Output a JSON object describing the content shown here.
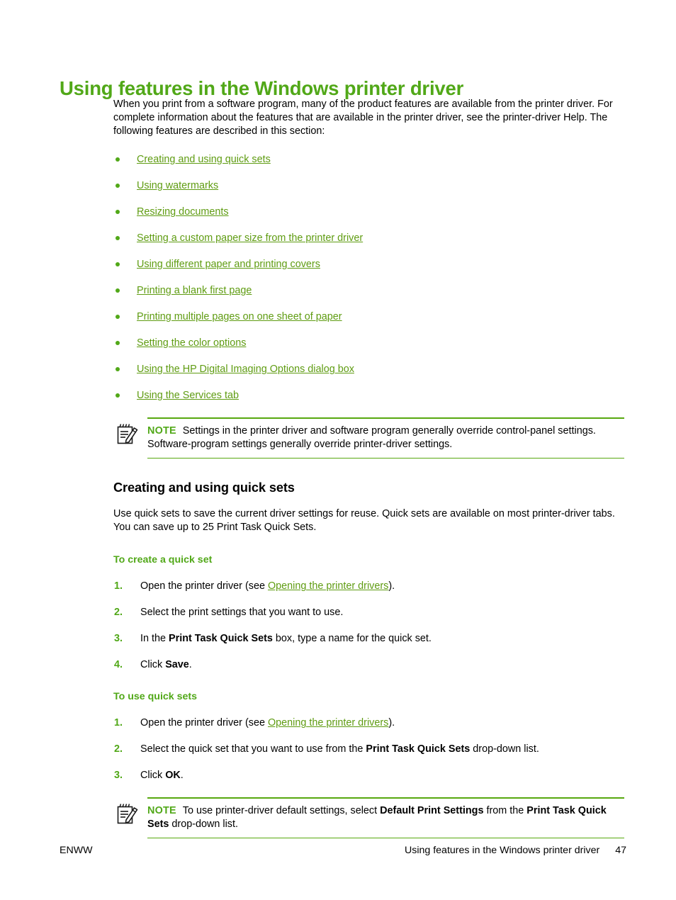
{
  "page": {
    "title": "Using features in the Windows printer driver",
    "intro": "When you print from a software program, many of the product features are available from the printer driver. For complete information about the features that are available in the printer driver, see the printer-driver Help. The following features are described in this section:",
    "accent_green": "#51a818",
    "link_green": "#5f9c12",
    "rule_green": "#57a80f"
  },
  "feature_links": [
    {
      "label": "Creating and using quick sets"
    },
    {
      "label": "Using watermarks"
    },
    {
      "label": "Resizing documents"
    },
    {
      "label": "Setting a custom paper size from the printer driver"
    },
    {
      "label": "Using different paper and printing covers"
    },
    {
      "label": "Printing a blank first page"
    },
    {
      "label": "Printing multiple pages on one sheet of paper"
    },
    {
      "label": "Setting the color options"
    },
    {
      "label": "Using the HP Digital Imaging Options dialog box"
    },
    {
      "label": "Using the Services tab"
    }
  ],
  "note_1": {
    "label": "NOTE",
    "icon": "note-pad-pencil-icon",
    "text": "Settings in the printer driver and software program generally override control-panel settings. Software-program settings generally override printer-driver settings."
  },
  "section": {
    "heading": "Creating and using quick sets",
    "body": "Use quick sets to save the current driver settings for reuse. Quick sets are available on most printer-driver tabs. You can save up to 25 Print Task Quick Sets."
  },
  "proc_create": {
    "heading": "To create a quick set",
    "steps": [
      {
        "num": "1.",
        "pre": "Open the printer driver (see ",
        "link": "Opening the printer drivers",
        "post": ")."
      },
      {
        "num": "2.",
        "pre": "Select the print settings that you want to use.",
        "link": "",
        "post": ""
      },
      {
        "num": "3.",
        "pre": "In the ",
        "bold": "Print Task Quick Sets",
        "post": " box, type a name for the quick set."
      },
      {
        "num": "4.",
        "pre": "Click ",
        "bold": "Save",
        "post": "."
      }
    ]
  },
  "proc_use": {
    "heading": "To use quick sets",
    "steps": [
      {
        "num": "1.",
        "pre": "Open the printer driver (see ",
        "link": "Opening the printer drivers",
        "post": ")."
      },
      {
        "num": "2.",
        "pre": "Select the quick set that you want to use from the ",
        "bold": "Print Task Quick Sets",
        "post": " drop-down list."
      },
      {
        "num": "3.",
        "pre": "Click ",
        "bold": "OK",
        "post": "."
      }
    ]
  },
  "note_2": {
    "label": "NOTE",
    "icon": "note-pad-pencil-icon",
    "text_1": "To use printer-driver default settings, select ",
    "bold_1": "Default Print Settings",
    "text_2": " from the ",
    "bold_2": "Print Task Quick Sets",
    "text_3": " drop-down list."
  },
  "footer": {
    "left": "ENWW",
    "right": "Using features in the Windows printer driver",
    "page_number": "47"
  }
}
